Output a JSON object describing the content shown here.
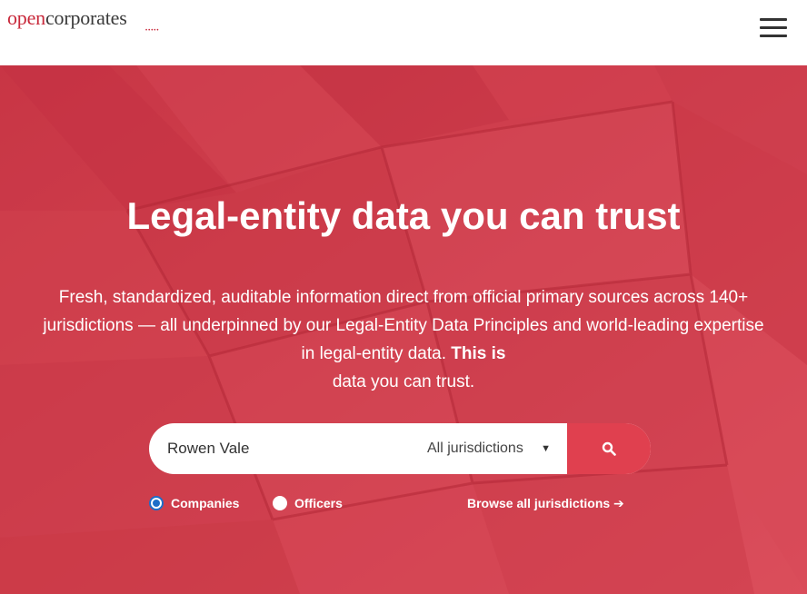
{
  "header": {
    "logo_part1": "open",
    "logo_part2": "corporates",
    "logo_dots": "•••••",
    "menu_icon": "hamburger-menu-icon"
  },
  "hero": {
    "title": "Legal-entity data you can trust",
    "description": "Fresh, standardized, auditable information direct from official primary sources across 140+ jurisdictions — all underpinned by our Legal-Entity Data Principles and world-leading expertise in legal-entity data.",
    "description_strong": "This is",
    "description_tail": "data you can trust."
  },
  "search": {
    "query": "Rowen Vale",
    "jurisdiction": "All jurisdictions",
    "search_icon": "search-icon"
  },
  "options": {
    "radio_companies": "Companies",
    "radio_officers": "Officers",
    "selected": "Companies",
    "browse_link": "Browse all jurisdictions",
    "arrow_icon": "arrow-right-icon"
  },
  "colors": {
    "brand": "#c8283a",
    "hero_bg": "#d2404f",
    "search_button": "#e0404f",
    "radio_checked": "#1e6ec8"
  }
}
